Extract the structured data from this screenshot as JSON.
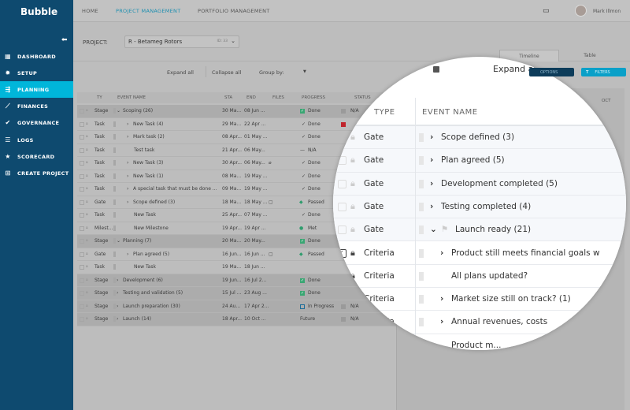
{
  "app": {
    "logo": "Bubble"
  },
  "topnav": {
    "items": [
      "HOME",
      "PROJECT MANAGEMENT",
      "PORTFOLIO MANAGEMENT"
    ],
    "active": "PROJECT MANAGEMENT",
    "user": "Mark Illmon"
  },
  "sidebar": {
    "items": [
      {
        "label": "DASHBOARD",
        "icon": "▦"
      },
      {
        "label": "SETUP",
        "icon": "✹"
      },
      {
        "label": "PLANNING",
        "icon": "⇶"
      },
      {
        "label": "FINANCES",
        "icon": "⟋"
      },
      {
        "label": "GOVERNANCE",
        "icon": "✔"
      },
      {
        "label": "LOGS",
        "icon": "☰"
      },
      {
        "label": "SCORECARD",
        "icon": "★"
      },
      {
        "label": "CREATE PROJECT",
        "icon": "⊞"
      }
    ],
    "active": "PLANNING"
  },
  "project": {
    "label": "PROJECT:",
    "value": "R - Betameg Rotors",
    "id": "ID: 33"
  },
  "toolbar": {
    "expand": "Expand all",
    "collapse": "Collapse all",
    "group_by": "Group by:",
    "options": "OPTIONS",
    "filters": "FILTERS"
  },
  "view_tabs": {
    "timeline": "Timeline",
    "table": "Table"
  },
  "timeline": {
    "month": "OCT"
  },
  "table": {
    "columns": [
      "TY",
      "EVENT NAME",
      "STA",
      "END",
      "FILES",
      "PROGRESS",
      "STATUS"
    ],
    "rows": [
      {
        "type": "Stage",
        "name": "Scoping (26)",
        "level": 0,
        "exp": "down",
        "start": "30 Ma...",
        "end": "08 Jun ...",
        "file": "",
        "progress": "Done",
        "picon": "box",
        "status": "N/A",
        "scolor": "#9a9a9a"
      },
      {
        "type": "Task",
        "name": "New Task (4)",
        "level": 1,
        "exp": "right",
        "start": "29 Ma...",
        "end": "22 Apr ...",
        "file": "",
        "progress": "Done",
        "picon": "check",
        "status": "",
        "scolor": "#c0242c"
      },
      {
        "type": "Task",
        "name": "Mark task (2)",
        "level": 1,
        "exp": "right",
        "start": "08 Apr...",
        "end": "01 May ...",
        "file": "",
        "progress": "Done",
        "picon": "check",
        "status": "",
        "scolor": ""
      },
      {
        "type": "Task",
        "name": "Test task",
        "level": 2,
        "exp": "",
        "start": "21 Apr...",
        "end": "06 May...",
        "file": "",
        "progress": "N/A",
        "picon": "dash",
        "status": "",
        "scolor": ""
      },
      {
        "type": "Task",
        "name": "New Task (3)",
        "level": 1,
        "exp": "right",
        "start": "30 Apr...",
        "end": "06 May...",
        "file": "clip",
        "progress": "Done",
        "picon": "check",
        "status": "",
        "scolor": ""
      },
      {
        "type": "Task",
        "name": "New Task (1)",
        "level": 1,
        "exp": "right",
        "start": "08 Ma...",
        "end": "19 May ...",
        "file": "",
        "progress": "Done",
        "picon": "check",
        "status": "",
        "scolor": ""
      },
      {
        "type": "Task",
        "name": "A special task that must be done ...",
        "level": 1,
        "exp": "right",
        "start": "09 Ma...",
        "end": "19 May ...",
        "file": "",
        "progress": "Done",
        "picon": "check",
        "status": "",
        "scolor": ""
      },
      {
        "type": "Gate",
        "name": "Scope defined (3)",
        "level": 1,
        "exp": "right",
        "start": "18 Ma...",
        "end": "18 May ...",
        "file": "doc",
        "progress": "Passed",
        "picon": "diamond",
        "status": "",
        "scolor": ""
      },
      {
        "type": "Task",
        "name": "New Task",
        "level": 2,
        "exp": "",
        "start": "25 Apr...",
        "end": "07 May ...",
        "file": "",
        "progress": "Done",
        "picon": "check",
        "status": "",
        "scolor": ""
      },
      {
        "type": "Milest...",
        "name": "New Milestone",
        "level": 2,
        "exp": "",
        "start": "19 Apr...",
        "end": "19 Apr ...",
        "file": "",
        "progress": "Met",
        "picon": "circle",
        "status": "",
        "scolor": ""
      },
      {
        "type": "Stage",
        "name": "Planning (7)",
        "level": 0,
        "exp": "down",
        "start": "20 Ma...",
        "end": "20 May...",
        "file": "",
        "progress": "Done",
        "picon": "box",
        "status": "",
        "scolor": ""
      },
      {
        "type": "Gate",
        "name": "Plan agreed (5)",
        "level": 1,
        "exp": "right",
        "start": "16 Jun...",
        "end": "16 Jun ...",
        "file": "doc",
        "progress": "Passed",
        "picon": "diamond",
        "status": "",
        "scolor": ""
      },
      {
        "type": "Task",
        "name": "New Task",
        "level": 2,
        "exp": "",
        "start": "19 Ma...",
        "end": "18 Jun ...",
        "file": "",
        "progress": "",
        "picon": "",
        "status": "",
        "scolor": ""
      },
      {
        "type": "Stage",
        "name": "Development (6)",
        "level": 0,
        "exp": "right",
        "start": "19 Jun...",
        "end": "16 Jul 2...",
        "file": "",
        "progress": "Done",
        "picon": "box",
        "status": "",
        "scolor": ""
      },
      {
        "type": "Stage",
        "name": "Testing and validation (5)",
        "level": 0,
        "exp": "right",
        "start": "15 Jul ...",
        "end": "23 Aug ...",
        "file": "",
        "progress": "Done",
        "picon": "box",
        "status": "",
        "scolor": ""
      },
      {
        "type": "Stage",
        "name": "Launch preparation (30)",
        "level": 0,
        "exp": "right",
        "start": "24 Au...",
        "end": "17 Apr 2...",
        "file": "",
        "progress": "In Progress",
        "picon": "play",
        "status": "N/A",
        "scolor": "#9a9a9a"
      },
      {
        "type": "Stage",
        "name": "Launch (14)",
        "level": 0,
        "exp": "right",
        "start": "18 Apr...",
        "end": "10 Oct ...",
        "file": "",
        "progress": "Future",
        "picon": "",
        "status": "N/A",
        "scolor": "#9a9a9a"
      }
    ]
  },
  "magnifier": {
    "columns": [
      "TYPE",
      "EVENT NAME"
    ],
    "expand_partial": "Expand all",
    "rows": [
      {
        "type": "Gate",
        "name": "Scope defined (3)",
        "exp": "right",
        "level": 0,
        "checked": false
      },
      {
        "type": "Gate",
        "name": "Plan agreed (5)",
        "exp": "right",
        "level": 0,
        "checked": false
      },
      {
        "type": "Gate",
        "name": "Development completed (5)",
        "exp": "right",
        "level": 0,
        "checked": false
      },
      {
        "type": "Gate",
        "name": "Testing completed (4)",
        "exp": "right",
        "level": 0,
        "checked": false
      },
      {
        "type": "Gate",
        "name": "Launch ready (21)",
        "exp": "down",
        "level": 0,
        "flag": true,
        "checked": false
      },
      {
        "type": "Criteria",
        "name": "Product still meets financial goals w",
        "exp": "right",
        "level": 1,
        "checked": true
      },
      {
        "type": "Criteria",
        "name": "All plans updated?",
        "exp": "",
        "level": 1,
        "checked": false
      },
      {
        "type": "Criteria",
        "name": "Market size still on track? (1)",
        "exp": "right",
        "level": 1,
        "checked": false
      },
      {
        "type": "Criteria",
        "name": "Annual revenues, costs",
        "exp": "right",
        "level": 1,
        "checked": false
      },
      {
        "type": "Criteria",
        "name": "Product m...",
        "exp": "",
        "level": 1,
        "checked": false
      }
    ]
  }
}
